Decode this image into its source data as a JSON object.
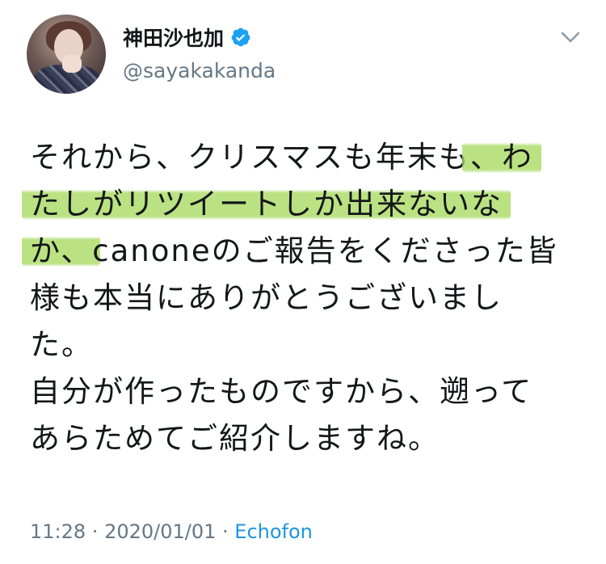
{
  "user": {
    "display_name": "神田沙也加",
    "handle": "@sayakakanda",
    "verified": true
  },
  "tweet": {
    "lines": [
      {
        "plain": "それから、クリスマスも年末も",
        "highlight": "、わ"
      },
      {
        "plain": "",
        "highlight": "たしがリツイートしか出来ないな"
      },
      {
        "highlight": "か、",
        "plain": "canoneのご報告をくださった皆"
      },
      {
        "plain": "様も本当にありがとうございまし",
        "highlight": ""
      },
      {
        "plain": "た。",
        "highlight": ""
      },
      {
        "plain": "自分が作ったものですから、遡って",
        "highlight": ""
      },
      {
        "plain": "あらためてご紹介しますね。",
        "highlight": ""
      }
    ]
  },
  "meta": {
    "time": "11:28",
    "separator": " · ",
    "date": "2020/01/01",
    "source": "Echofon"
  },
  "icons": {
    "verified": "verified-badge-icon",
    "menu": "chevron-down-icon"
  },
  "colors": {
    "highlight": "#a8da5f",
    "link": "#1b95e0",
    "secondary_text": "#657786",
    "verified": "#1da1f2"
  }
}
